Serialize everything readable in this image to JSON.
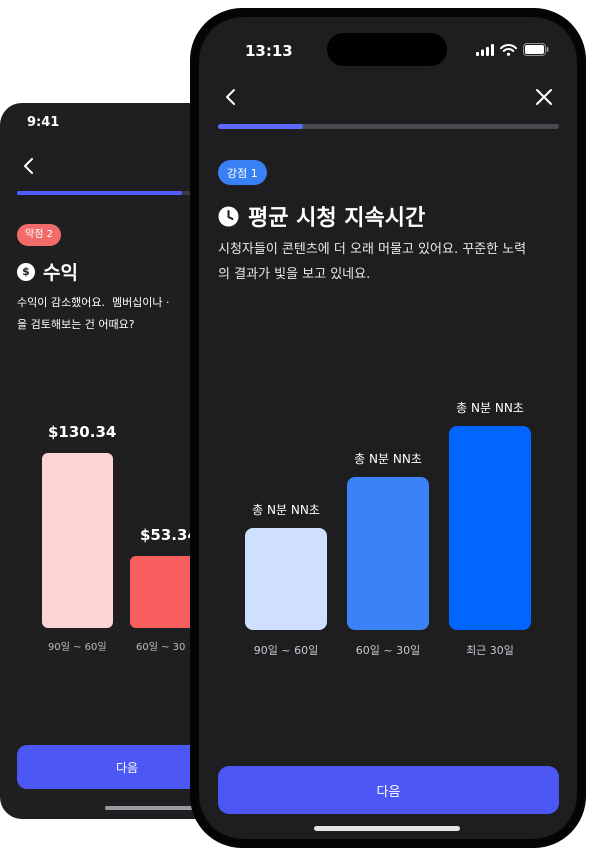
{
  "back_screen": {
    "status_time": "9:41",
    "progress": 0.9,
    "badge": "약점 2",
    "badge_color": "#f26b6b",
    "title": "수익",
    "title_icon": "dollar-circle-icon",
    "description": "수익이 감소했어요.  멤버십이나 ·\n을 검토해보는 건 어때요?",
    "chart_data": {
      "type": "bar",
      "categories": [
        "90일 ~ 60일",
        "60일 ~ 30"
      ],
      "value_labels": [
        "$130.34",
        "$53.34"
      ],
      "values": [
        130.34,
        53.34
      ],
      "colors": [
        "#fcd4d4",
        "#fa5f5f"
      ]
    },
    "next_label": "다음"
  },
  "front_screen": {
    "status_time": "13:13",
    "progress": 0.25,
    "badge": "강점 1",
    "badge_color": "#3a80f5",
    "title": "평균 시청 지속시간",
    "title_icon": "clock-icon",
    "description": "시청자들이 콘텐츠에 더 오래 머물고 있어요. 꾸준한 노력\n의 결과가 빛을 보고 있네요.",
    "chart_data": {
      "type": "bar",
      "categories": [
        "90일 ~ 60일",
        "60일 ~ 30일",
        "최근 30일"
      ],
      "value_labels": [
        "총 N분 NN초",
        "총 N분 NN초",
        "총 N분 NN초"
      ],
      "relative_values": [
        0.5,
        0.75,
        1.0
      ],
      "colors": [
        "#cfe0ff",
        "#3b82f8",
        "#0066ff"
      ]
    },
    "next_label": "다음"
  },
  "colors": {
    "screen_bg": "#1e1e20",
    "button": "#4c57f5",
    "progress_fill": "#5b6bff"
  }
}
